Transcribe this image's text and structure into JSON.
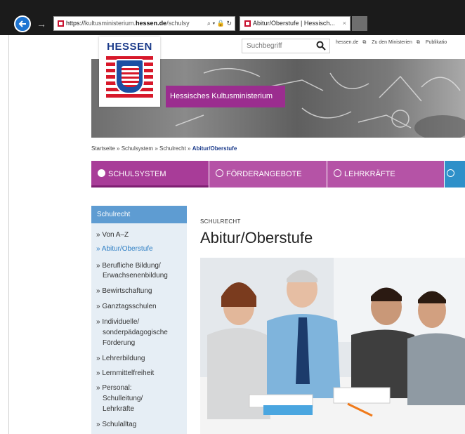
{
  "browser": {
    "address": {
      "url_prefix": "https://",
      "url_domain_start": "kultusministerium.",
      "url_domain": "hessen.de",
      "url_path": "/schulsy",
      "icons": "⌕ ▾ 🔒 ↻"
    },
    "tab": {
      "title": "Abitur/Oberstufe | Hessisch...",
      "close": "×"
    }
  },
  "header": {
    "logo_text": "HESSEN",
    "search_placeholder": "Suchbegriff",
    "top_links": [
      "hessen.de",
      "Zu den Ministerien",
      "Publikatio"
    ],
    "ministry_label": "Hessisches Kultusministerium"
  },
  "breadcrumb": {
    "items": [
      "Startseite",
      "Schulsystem",
      "Schulrecht"
    ],
    "separator": "»",
    "current": "Abitur/Oberstufe"
  },
  "mainnav": {
    "items": [
      "SCHULSYSTEM",
      "FÖRDERANGEBOTE",
      "LEHRKRÄFTE",
      ""
    ]
  },
  "sidebar": {
    "heading": "Schulrecht",
    "items": [
      "» Von A–Z",
      "» Abitur/Oberstufe",
      "» Berufliche Bildung/",
      "Erwachsenenbildung",
      "» Bewirtschaftung",
      "» Ganztagsschulen",
      "» Individuelle/",
      "sonderpädagogische",
      "Förderung",
      "» Lehrerbildung",
      "» Lernmittelfreiheit",
      "» Personal:",
      "Schulleitung/",
      "Lehrkräfte",
      "» Schulalltag"
    ]
  },
  "content": {
    "kicker": "SCHULRECHT",
    "title": "Abitur/Oberstufe"
  },
  "colors": {
    "nav_purple": "#a83c98",
    "ministry_purple": "#9b2d8f",
    "sidebar_blue": "#5e9cd2",
    "link_blue": "#2f7fc4",
    "nav_blue": "#2e90c9"
  }
}
